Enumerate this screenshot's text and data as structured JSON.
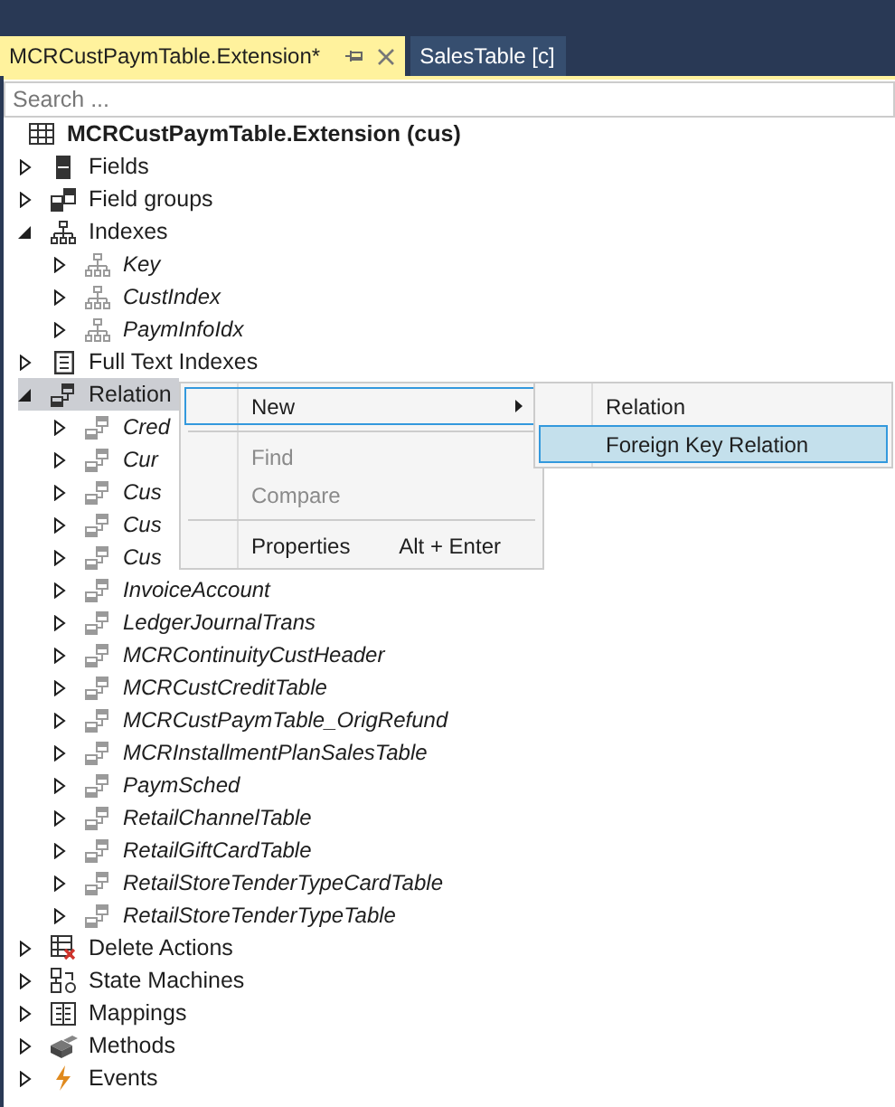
{
  "tabs": [
    {
      "label": "MCRCustPaymTable.Extension*",
      "selected": true
    },
    {
      "label": "SalesTable [c]",
      "selected": false
    }
  ],
  "search": {
    "placeholder": "Search ..."
  },
  "root": {
    "label": "MCRCustPaymTable.Extension (cus)",
    "kind": "table"
  },
  "items": [
    {
      "label": "Fields",
      "kind": "field",
      "expanded": false,
      "selected": false,
      "inherited": false
    },
    {
      "label": "Field groups",
      "kind": "fieldgroup",
      "expanded": false,
      "selected": false,
      "inherited": false
    },
    {
      "label": "Indexes",
      "kind": "index",
      "expanded": true,
      "selected": false,
      "inherited": false,
      "children": [
        {
          "label": "Key",
          "kind": "index",
          "expanded": false,
          "selected": false,
          "inherited": true
        },
        {
          "label": "CustIndex",
          "kind": "index",
          "expanded": false,
          "selected": false,
          "inherited": true
        },
        {
          "label": "PaymInfoIdx",
          "kind": "index",
          "expanded": false,
          "selected": false,
          "inherited": true
        }
      ]
    },
    {
      "label": "Full Text Indexes",
      "kind": "fulltext",
      "expanded": false,
      "selected": false,
      "inherited": false
    },
    {
      "label": "Relation",
      "kind": "relation",
      "expanded": true,
      "selected": true,
      "inherited": false,
      "children": [
        {
          "label": "Cred",
          "kind": "relation",
          "expanded": false,
          "selected": false,
          "inherited": true
        },
        {
          "label": "Cur",
          "kind": "relation",
          "expanded": false,
          "selected": false,
          "inherited": true
        },
        {
          "label": "Cus",
          "kind": "relation",
          "expanded": false,
          "selected": false,
          "inherited": true
        },
        {
          "label": "Cus",
          "kind": "relation",
          "expanded": false,
          "selected": false,
          "inherited": true
        },
        {
          "label": "Cus",
          "kind": "relation",
          "expanded": false,
          "selected": false,
          "inherited": true
        },
        {
          "label": "InvoiceAccount",
          "kind": "relation",
          "expanded": false,
          "selected": false,
          "inherited": true
        },
        {
          "label": "LedgerJournalTrans",
          "kind": "relation",
          "expanded": false,
          "selected": false,
          "inherited": true
        },
        {
          "label": "MCRContinuityCustHeader",
          "kind": "relation",
          "expanded": false,
          "selected": false,
          "inherited": true
        },
        {
          "label": "MCRCustCreditTable",
          "kind": "relation",
          "expanded": false,
          "selected": false,
          "inherited": true
        },
        {
          "label": "MCRCustPaymTable_OrigRefund",
          "kind": "relation",
          "expanded": false,
          "selected": false,
          "inherited": true
        },
        {
          "label": "MCRInstallmentPlanSalesTable",
          "kind": "relation",
          "expanded": false,
          "selected": false,
          "inherited": true
        },
        {
          "label": "PaymSched",
          "kind": "relation",
          "expanded": false,
          "selected": false,
          "inherited": true
        },
        {
          "label": "RetailChannelTable",
          "kind": "relation",
          "expanded": false,
          "selected": false,
          "inherited": true
        },
        {
          "label": "RetailGiftCardTable",
          "kind": "relation",
          "expanded": false,
          "selected": false,
          "inherited": true
        },
        {
          "label": "RetailStoreTenderTypeCardTable",
          "kind": "relation",
          "expanded": false,
          "selected": false,
          "inherited": true
        },
        {
          "label": "RetailStoreTenderTypeTable",
          "kind": "relation",
          "expanded": false,
          "selected": false,
          "inherited": true
        }
      ]
    },
    {
      "label": "Delete Actions",
      "kind": "deleteaction",
      "expanded": false,
      "selected": false,
      "inherited": false
    },
    {
      "label": "State Machines",
      "kind": "statemachine",
      "expanded": false,
      "selected": false,
      "inherited": false
    },
    {
      "label": "Mappings",
      "kind": "mapping",
      "expanded": false,
      "selected": false,
      "inherited": false
    },
    {
      "label": "Methods",
      "kind": "method",
      "expanded": false,
      "selected": false,
      "inherited": false
    },
    {
      "label": "Events",
      "kind": "event",
      "expanded": false,
      "selected": false,
      "inherited": false
    }
  ],
  "context_menu": {
    "items": [
      {
        "kind": "item",
        "label": "New",
        "submenu": true,
        "selected": true,
        "disabled": false
      },
      {
        "kind": "separator"
      },
      {
        "kind": "item",
        "label": "Find",
        "submenu": false,
        "selected": false,
        "disabled": true
      },
      {
        "kind": "item",
        "label": "Compare",
        "submenu": false,
        "selected": false,
        "disabled": true
      },
      {
        "kind": "separator"
      },
      {
        "kind": "item",
        "label": "Properties",
        "shortcut": "Alt + Enter",
        "submenu": false,
        "selected": false,
        "disabled": false
      }
    ]
  },
  "submenu": {
    "items": [
      {
        "label": "Relation",
        "selected": false
      },
      {
        "label": "Foreign Key Relation",
        "selected": true
      }
    ]
  }
}
